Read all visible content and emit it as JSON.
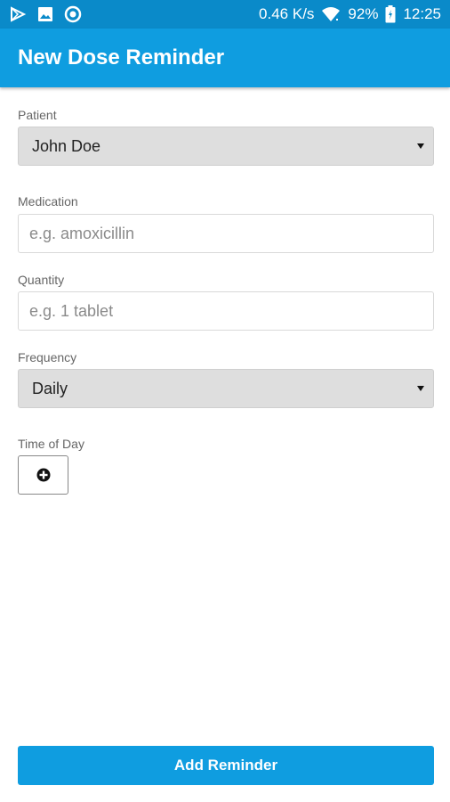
{
  "status_bar": {
    "network_speed": "0.46 K/s",
    "battery_percent": "92%",
    "time": "12:25",
    "left_icons": [
      "play-store-icon",
      "image-icon",
      "circle-notification-icon"
    ],
    "right_icons": [
      "wifi-icon",
      "battery-icon"
    ]
  },
  "header": {
    "title": "New Dose Reminder"
  },
  "form": {
    "patient": {
      "label": "Patient",
      "value": "John Doe"
    },
    "medication": {
      "label": "Medication",
      "placeholder": "e.g. amoxicillin",
      "value": ""
    },
    "quantity": {
      "label": "Quantity",
      "placeholder": "e.g. 1 tablet",
      "value": ""
    },
    "frequency": {
      "label": "Frequency",
      "value": "Daily"
    },
    "time_of_day": {
      "label": "Time of Day",
      "add_icon": "plus-circle-icon"
    }
  },
  "actions": {
    "submit_label": "Add Reminder"
  },
  "colors": {
    "status_bar": "#0a8ac9",
    "app_bar": "#0f9de0",
    "primary_button": "#0f9de0"
  }
}
